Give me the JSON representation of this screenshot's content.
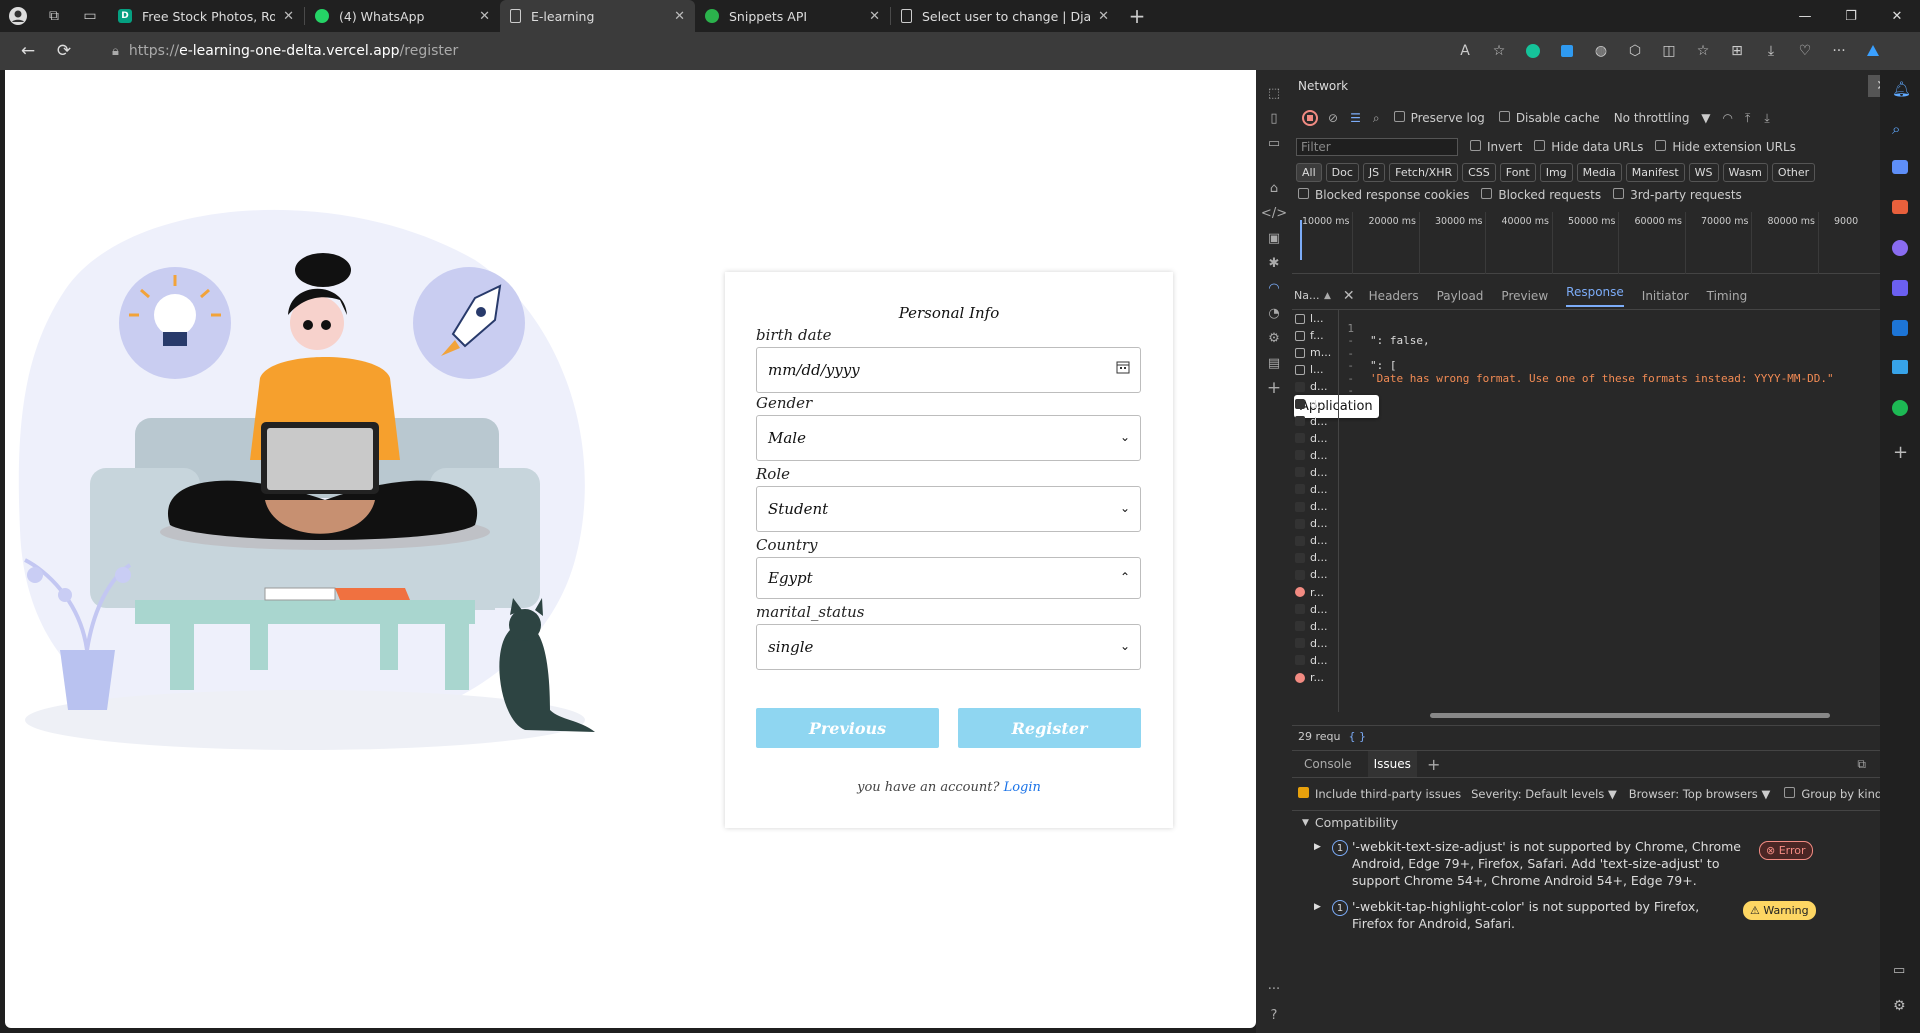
{
  "browser": {
    "tabs": [
      {
        "title": "Free Stock Photos, Royalty Free S",
        "favicon_color": "#05a081",
        "favicon_text": "D"
      },
      {
        "title": "(4) WhatsApp",
        "favicon_color": "#25d366",
        "favicon_text": ""
      },
      {
        "title": "E-learning",
        "favicon_color": "",
        "favicon_text": ""
      },
      {
        "title": "Snippets API",
        "favicon_color": "#2bb24c",
        "favicon_text": ""
      },
      {
        "title": "Select user to change | Django si",
        "favicon_color": "",
        "favicon_text": ""
      }
    ],
    "active_tab_index": 2,
    "url_scheme": "https://",
    "url_host": "e-learning-one-delta.vercel.app",
    "url_path": "/register"
  },
  "form": {
    "heading": "Personal Info",
    "birth_date_label": "birth date",
    "birth_date_placeholder": "mm/dd/yyyy",
    "gender_label": "Gender",
    "gender_value": "Male",
    "role_label": "Role",
    "role_value": "Student",
    "country_label": "Country",
    "country_value": "Egypt",
    "marital_label": "marital_status",
    "marital_value": "single",
    "previous_label": "Previous",
    "register_label": "Register",
    "account_prompt": "you have an account?",
    "login_link": "Login",
    "button_color": "#8fd6f1"
  },
  "devtools": {
    "panel_title": "Network",
    "preserve_log": "Preserve log",
    "disable_cache": "Disable cache",
    "throttling": "No throttling",
    "filter_placeholder": "Filter",
    "invert": "Invert",
    "hide_data_urls": "Hide data URLs",
    "hide_extension_urls": "Hide extension URLs",
    "type_filters": [
      "All",
      "Doc",
      "JS",
      "Fetch/XHR",
      "CSS",
      "Font",
      "Img",
      "Media",
      "Manifest",
      "WS",
      "Wasm",
      "Other"
    ],
    "blocked_response_cookies": "Blocked response cookies",
    "blocked_requests": "Blocked requests",
    "third_party_requests": "3rd-party requests",
    "timeline_ticks": [
      "10000 ms",
      "20000 ms",
      "30000 ms",
      "40000 ms",
      "50000 ms",
      "60000 ms",
      "70000 ms",
      "80000 ms",
      "9000"
    ],
    "name_header": "Na...",
    "request_names": [
      "l...",
      "f...",
      "m...",
      "l...",
      "d...",
      "d...",
      "d...",
      "d...",
      "d...",
      "d...",
      "d...",
      "d...",
      "d...",
      "d...",
      "d...",
      "d...",
      "r...",
      "d...",
      "d...",
      "d...",
      "d...",
      "r..."
    ],
    "detail_tabs": [
      "Headers",
      "Payload",
      "Preview",
      "Response",
      "Initiator",
      "Timing"
    ],
    "active_detail_tab": "Response",
    "response_lines": [
      {
        "num": "1",
        "text": "",
        "str": ""
      },
      {
        "num": "-",
        "text": "\": false,",
        "str": ""
      },
      {
        "num": "-",
        "text": "",
        "str": ""
      },
      {
        "num": "-",
        "text": "\": [",
        "str": ""
      },
      {
        "num": "-",
        "text": "",
        "str": "'Date has wrong format. Use one of these formats instead: YYYY-MM-DD.\""
      },
      {
        "num": "-",
        "text": "",
        "str": ""
      },
      {
        "num": "-",
        "text": "",
        "str": ""
      }
    ],
    "tooltip": "Application",
    "request_count": "29 requ",
    "braces": "{ }",
    "drawer_tabs": [
      "Console",
      "Issues"
    ],
    "active_drawer_tab": "Issues",
    "include_third_party": "Include third-party issues",
    "severity_label": "Severity:",
    "severity_value": "Default levels",
    "browser_label": "Browser:",
    "browser_value": "Top browsers",
    "group_by_kind": "Group by kind",
    "category": "Compatibility",
    "issues": [
      {
        "count": "1",
        "text": "'-webkit-text-size-adjust' is not supported by Chrome, Chrome Android, Edge 79+, Firefox, Safari. Add 'text-size-adjust' to support Chrome 54+, Chrome Android 54+, Edge 79+.",
        "badge": "Error",
        "badge_color": "#f28b82"
      },
      {
        "count": "1",
        "text": "'-webkit-tap-highlight-color' is not supported by Firefox, Firefox for Android, Safari.",
        "badge": "Warning",
        "badge_color": "#fdd663"
      }
    ]
  }
}
